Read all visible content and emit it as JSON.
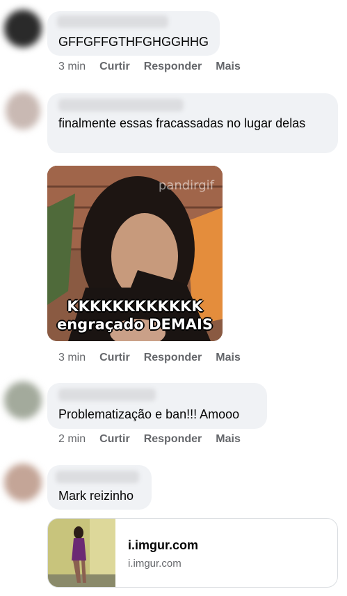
{
  "comments": [
    {
      "text": "GFFGFFGTHFGHGGHHG",
      "time": "3 min"
    },
    {
      "text": "finalmente essas fracassadas no lugar delas",
      "time": "3 min"
    },
    {
      "text": "Problematização e ban!!! Amooo",
      "time": "2 min"
    },
    {
      "text": "Mark reizinho"
    }
  ],
  "gif": {
    "watermark": "pandirgif",
    "caption_line1": "KKKKKKKKKKKK",
    "caption_line2": "engraçado DEMAIS"
  },
  "link_preview": {
    "title": "i.imgur.com",
    "domain": "i.imgur.com"
  },
  "actions": {
    "like": "Curtir",
    "reply": "Responder",
    "more": "Mais"
  }
}
